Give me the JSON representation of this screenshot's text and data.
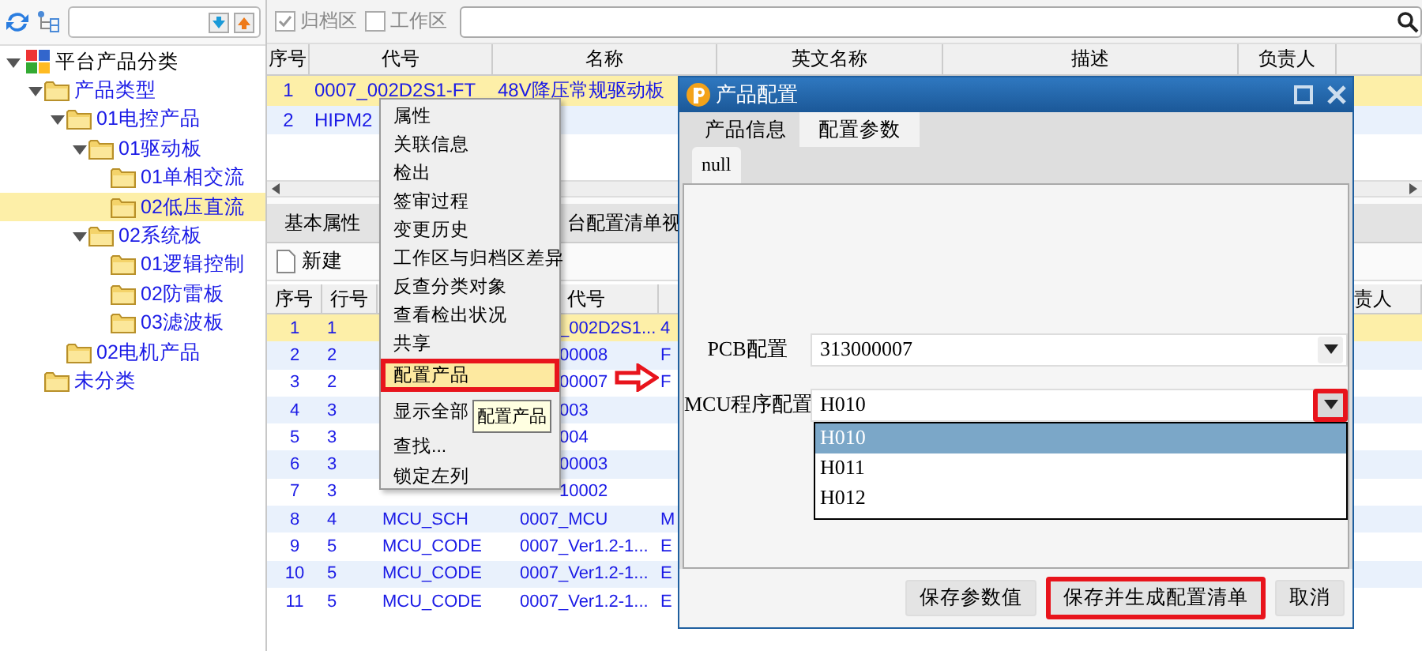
{
  "tree": [
    {
      "label": "平台产品分类",
      "kind": "root",
      "expanded": true,
      "selected": false,
      "children": [
        {
          "label": "产品类型",
          "kind": "folder",
          "expanded": true,
          "selected": false,
          "children": [
            {
              "label": "01电控产品",
              "kind": "folder",
              "expanded": true,
              "selected": false,
              "children": [
                {
                  "label": "01驱动板",
                  "kind": "folder",
                  "expanded": true,
                  "selected": false,
                  "children": [
                    {
                      "label": "01单相交流",
                      "kind": "folder",
                      "selected": false
                    },
                    {
                      "label": "02低压直流",
                      "kind": "folder",
                      "selected": true
                    }
                  ]
                },
                {
                  "label": "02系统板",
                  "kind": "folder",
                  "expanded": true,
                  "selected": false,
                  "children": [
                    {
                      "label": "01逻辑控制",
                      "kind": "folder",
                      "selected": false
                    },
                    {
                      "label": "02防雷板",
                      "kind": "folder",
                      "selected": false
                    },
                    {
                      "label": "03滤波板",
                      "kind": "folder",
                      "selected": false
                    }
                  ]
                }
              ]
            },
            {
              "label": "02电机产品",
              "kind": "folder",
              "selected": false
            }
          ]
        },
        {
          "label": "未分类",
          "kind": "folder",
          "selected": false
        }
      ]
    }
  ],
  "filters": [
    {
      "label": "归档区",
      "checked": true
    },
    {
      "label": "工作区",
      "checked": false
    }
  ],
  "top_table": {
    "columns": [
      "序号",
      "代号",
      "名称",
      "英文名称",
      "描述",
      "负责人"
    ],
    "rows": [
      {
        "cells": [
          "1",
          "0007_002D2S1-FT",
          "48V降压常规驱动板"
        ],
        "selected": true
      },
      {
        "cells": [
          "2",
          "HIPM2"
        ],
        "selected": false
      }
    ]
  },
  "detail_tabs": [
    {
      "label": "基本属性",
      "selected": false
    },
    {
      "label": "台配置清单视",
      "selected": false
    }
  ],
  "detail_toolbar": {
    "new_label": "新建"
  },
  "detail_table": {
    "columns": [
      "序号",
      "行号",
      "代号",
      "责人"
    ],
    "rows": [
      {
        "no": "1",
        "line": "1",
        "code": "_002D2S1...",
        "column_5": "4",
        "selected": true
      },
      {
        "no": "2",
        "line": "2",
        "code": "00008",
        "column_5": "F",
        "selected": false
      },
      {
        "no": "3",
        "line": "2",
        "code": "00007",
        "column_5": "F",
        "selected": false
      },
      {
        "no": "4",
        "line": "3",
        "code": "003",
        "selected": false
      },
      {
        "no": "5",
        "line": "3",
        "code": "004",
        "selected": false
      },
      {
        "no": "6",
        "line": "3",
        "code": "00003",
        "selected": false
      },
      {
        "no": "7",
        "line": "3",
        "code": "10002",
        "selected": false
      },
      {
        "no": "8",
        "line": "4",
        "column_3": "MCU_SCH",
        "code": "0007_MCU",
        "column_5": "M",
        "selected": false
      },
      {
        "no": "9",
        "line": "5",
        "column_3": "MCU_CODE",
        "code": "0007_Ver1.2-1...",
        "column_5": "E",
        "selected": false
      },
      {
        "no": "10",
        "line": "5",
        "column_3": "MCU_CODE",
        "code": "0007_Ver1.2-1...",
        "column_5": "E",
        "selected": false
      },
      {
        "no": "11",
        "line": "5",
        "column_3": "MCU_CODE",
        "code": "0007_Ver1.2-1...",
        "column_5": "E",
        "selected": false
      }
    ]
  },
  "context_menu": {
    "sections": [
      [
        {
          "label": "属性",
          "selected": false,
          "annotated": false
        },
        {
          "label": "关联信息",
          "selected": false,
          "annotated": false
        },
        {
          "label": "检出",
          "selected": false,
          "annotated": false
        },
        {
          "label": "签审过程",
          "selected": false,
          "annotated": false
        },
        {
          "label": "变更历史",
          "selected": false,
          "annotated": false
        },
        {
          "label": "工作区与归档区差异",
          "selected": false,
          "annotated": false
        },
        {
          "label": "反查分类对象",
          "selected": false,
          "annotated": false
        },
        {
          "label": "查看检出状况",
          "selected": false,
          "annotated": false
        },
        {
          "label": "共享",
          "selected": false,
          "annotated": false
        },
        {
          "label": "配置产品",
          "selected": true,
          "annotated": true
        }
      ],
      [
        {
          "label": "显示全部",
          "selected": false,
          "annotated": false
        }
      ],
      [
        {
          "label": "查找...",
          "selected": false,
          "annotated": false
        },
        {
          "label": "锁定左列",
          "selected": false,
          "annotated": false
        }
      ]
    ]
  },
  "tooltip": "配置产品",
  "dialog": {
    "title": "产品配置",
    "tabs": [
      {
        "label": "产品信息",
        "selected": false
      },
      {
        "label": "配置参数",
        "selected": true
      }
    ],
    "subtabs": [
      {
        "label": "null",
        "selected": true
      }
    ],
    "fields": [
      {
        "label": "PCB配置",
        "value": "313000007",
        "annotated": false
      },
      {
        "label": "MCU程序配置",
        "value": "H010",
        "annotated": true,
        "expanded": true,
        "options": [
          {
            "label": "H010",
            "selected": true
          },
          {
            "label": "H011",
            "selected": false
          },
          {
            "label": "H012",
            "selected": false
          }
        ]
      }
    ],
    "buttons": [
      {
        "label": "保存参数值",
        "annotated": false
      },
      {
        "label": "保存并生成配置清单",
        "annotated": true
      },
      {
        "label": "取消",
        "annotated": false
      }
    ]
  }
}
